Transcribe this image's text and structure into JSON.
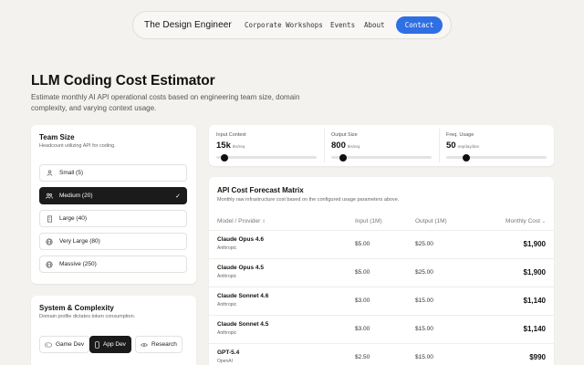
{
  "nav": {
    "brand": "The Design Engineer",
    "links": [
      "Corporate Workshops",
      "Events",
      "About"
    ],
    "cta": "Contact"
  },
  "hero": {
    "title": "LLM Coding Cost Estimator",
    "subtitle": "Estimate monthly AI API operational costs based on engineering team size, domain complexity, and varying context usage."
  },
  "team": {
    "title": "Team Size",
    "subtitle": "Headcount utilizing API for coding.",
    "options": [
      {
        "label": "Small (5)",
        "icon": "user-icon"
      },
      {
        "label": "Medium (20)",
        "icon": "users-icon",
        "selected": true
      },
      {
        "label": "Large (40)",
        "icon": "building-icon"
      },
      {
        "label": "Very Large (80)",
        "icon": "globe-icon"
      },
      {
        "label": "Massive (250)",
        "icon": "globe-icon"
      }
    ]
  },
  "system": {
    "title": "System & Complexity",
    "subtitle": "Domain profile dictates token consumption.",
    "chips": [
      {
        "label": "Game Dev",
        "icon": "gamepad-icon"
      },
      {
        "label": "App Dev",
        "icon": "phone-icon",
        "selected": true
      },
      {
        "label": "Research",
        "icon": "eye-icon"
      }
    ]
  },
  "sliders": [
    {
      "label": "Input Context",
      "value": "15k",
      "unit": "tks/req",
      "level": 0.05
    },
    {
      "label": "Output Size",
      "value": "800",
      "unit": "tks/req",
      "level": 0.09
    },
    {
      "label": "Freq. Usage",
      "value": "50",
      "unit": "req/day/dev",
      "level": 0.18
    }
  ],
  "matrix": {
    "title": "API Cost Forecast Matrix",
    "subtitle": "Monthly raw infrastructure cost based on the configured usage parameters above.",
    "headers": {
      "model": "Model / Provider",
      "input": "Input (1M)",
      "output": "Output (1M)",
      "cost": "Monthly Cost"
    },
    "rows": [
      {
        "name": "Claude Opus 4.6",
        "provider": "Anthropic",
        "input": "$5.00",
        "output": "$25.00",
        "cost": "$1,900"
      },
      {
        "name": "Claude Opus 4.5",
        "provider": "Anthropic",
        "input": "$5.00",
        "output": "$25.00",
        "cost": "$1,900"
      },
      {
        "name": "Claude Sonnet 4.6",
        "provider": "Anthropic",
        "input": "$3.00",
        "output": "$15.00",
        "cost": "$1,140"
      },
      {
        "name": "Claude Sonnet 4.5",
        "provider": "Anthropic",
        "input": "$3.00",
        "output": "$15.00",
        "cost": "$1,140"
      },
      {
        "name": "GPT-5.4",
        "provider": "OpenAI",
        "input": "$2.50",
        "output": "$15.00",
        "cost": "$990"
      }
    ]
  },
  "colors": {
    "accent": "#2f6fe4",
    "selected": "#1b1b1b",
    "background": "#f3f2ef"
  }
}
